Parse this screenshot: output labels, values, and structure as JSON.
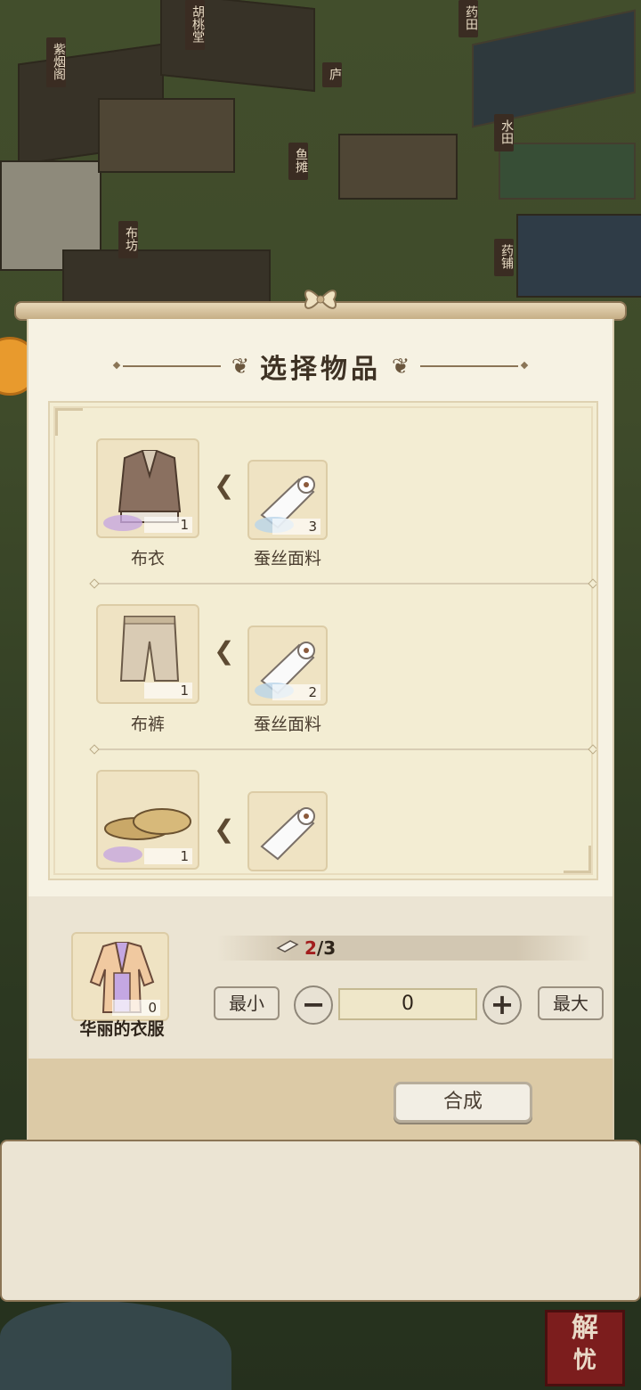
{
  "map": {
    "signs": [
      "胡桃堂",
      "药田",
      "紫烟阁",
      "庐",
      "水田",
      "鱼摊",
      "布坊",
      "药铺"
    ],
    "seal": [
      "解",
      "忧"
    ]
  },
  "dialog": {
    "title": "选择物品",
    "recipes": [
      {
        "product": {
          "name": "布衣",
          "count": "1",
          "icon": "cloth-shirt-icon"
        },
        "material": {
          "name": "蚕丝面料",
          "count": "3",
          "icon": "silk-roll-icon"
        }
      },
      {
        "product": {
          "name": "布裤",
          "count": "1",
          "icon": "cloth-pants-icon"
        },
        "material": {
          "name": "蚕丝面料",
          "count": "2",
          "icon": "silk-roll-icon"
        }
      },
      {
        "product": {
          "name": "",
          "count": "1",
          "icon": "straw-shoes-icon"
        },
        "material": {
          "name": "",
          "count": "",
          "icon": "silk-roll-icon"
        }
      }
    ],
    "target": {
      "name": "华丽的衣服",
      "count": "0",
      "icon": "fancy-robe-icon"
    },
    "materials": {
      "have": "2",
      "need": "/3"
    },
    "controls": {
      "min_label": "最小",
      "max_label": "最大",
      "minus": "−",
      "plus": "+",
      "quantity": "0"
    },
    "combine_label": "合成"
  }
}
